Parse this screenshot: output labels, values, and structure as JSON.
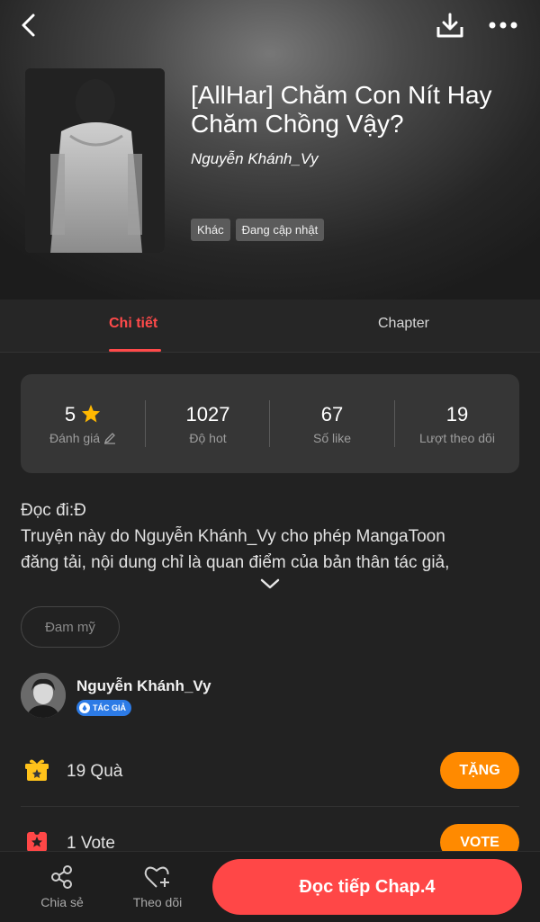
{
  "header": {
    "title": "[AllHar] Chăm Con Nít Hay Chăm Chồng Vậy?",
    "author": "Nguyễn Khánh_Vy",
    "tags": [
      "Khác",
      "Đang cập nhật"
    ]
  },
  "tabs": {
    "detail": "Chi tiết",
    "chapter": "Chapter",
    "active": "detail"
  },
  "stats": [
    {
      "value": "5",
      "label": "Đánh giá"
    },
    {
      "value": "1027",
      "label": "Độ hot"
    },
    {
      "value": "67",
      "label": "Số like"
    },
    {
      "value": "19",
      "label": "Lượt theo dõi"
    }
  ],
  "description": {
    "lines": [
      "Đọc đi:Đ",
      "Truyện này do Nguyễn Khánh_Vy cho phép MangaToon",
      "đăng tải, nội dung chỉ là quan điểm của bản thân tác giả,"
    ]
  },
  "genre": "Đam mỹ",
  "author_section": {
    "name": "Nguyễn Khánh_Vy",
    "badge": "TÁC GIẢ"
  },
  "gifts": {
    "text": "19 Quà",
    "button": "TẶNG"
  },
  "votes": {
    "text": "1 Vote",
    "button": "VOTE"
  },
  "bottom_bar": {
    "share": "Chia sẻ",
    "follow": "Theo dõi",
    "read": "Đọc tiếp Chap.4"
  },
  "colors": {
    "accent": "#ff4747",
    "button_orange": "#ff8a00",
    "badge_blue": "#2d7be6",
    "star": "#ffb800"
  }
}
